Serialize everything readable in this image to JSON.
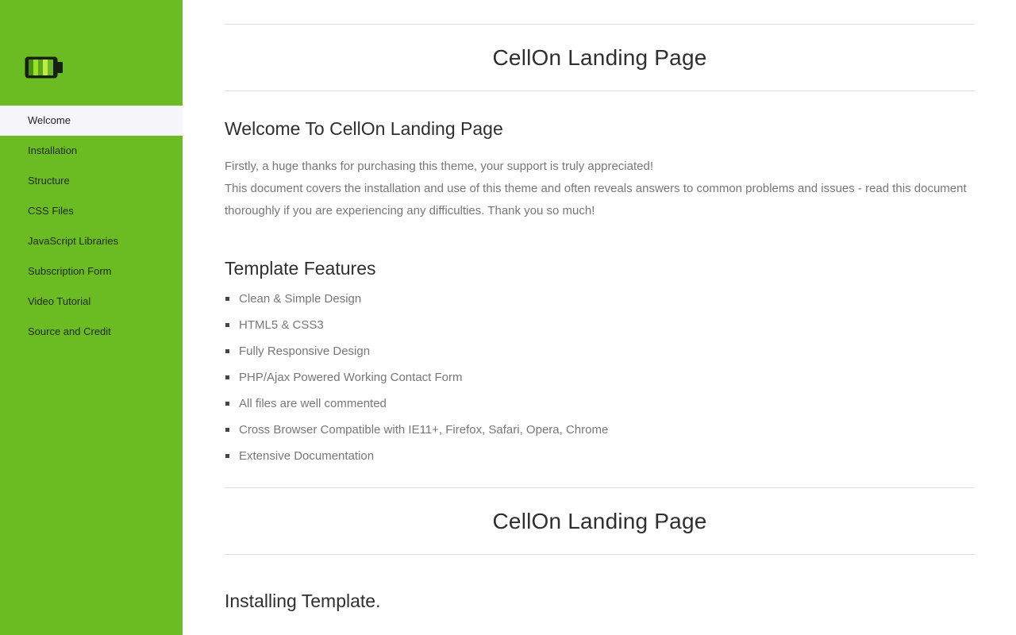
{
  "sidebar": {
    "logo": "battery-icon",
    "items": [
      {
        "label": "Welcome",
        "active": true
      },
      {
        "label": "Installation"
      },
      {
        "label": "Structure"
      },
      {
        "label": "CSS Files"
      },
      {
        "label": "JavaScript Libraries"
      },
      {
        "label": "Subscription Form"
      },
      {
        "label": "Video Tutorial"
      },
      {
        "label": "Source and Credit"
      }
    ]
  },
  "main": {
    "page_title": "CellOn Landing Page",
    "welcome_heading": "Welcome To CellOn Landing Page",
    "intro_line_1": "Firstly, a huge thanks for purchasing this theme, your support is truly appreciated!",
    "intro_line_2": "This document covers the installation and use of this theme and often reveals answers to common problems and issues - read this document thoroughly if you are experiencing any difficulties. Thank you so much!",
    "features_heading": "Template Features",
    "features": [
      "Clean & Simple Design",
      "HTML5 & CSS3",
      "Fully Responsive Design",
      "PHP/Ajax Powered Working Contact Form",
      "All files are well commented",
      "Cross Browser Compatible with IE11+, Firefox, Safari, Opera, Chrome",
      "Extensive Documentation"
    ],
    "second_page_title": "CellOn Landing Page",
    "installing_heading": "Installing Template."
  },
  "colors": {
    "sidebar_green": "#6bbb22",
    "active_item_bg": "#f6f6fa",
    "heading_text": "#2f2f2f",
    "body_text": "#777777"
  }
}
